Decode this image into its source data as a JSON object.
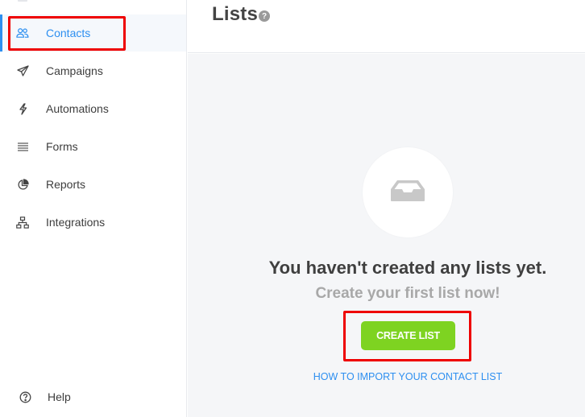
{
  "sidebar": {
    "items": [
      {
        "label": "Contacts",
        "icon": "users-icon",
        "active": true
      },
      {
        "label": "Campaigns",
        "icon": "paper-plane-icon"
      },
      {
        "label": "Automations",
        "icon": "lightning-icon"
      },
      {
        "label": "Forms",
        "icon": "lines-icon"
      },
      {
        "label": "Reports",
        "icon": "pie-chart-icon"
      },
      {
        "label": "Integrations",
        "icon": "sitemap-icon"
      }
    ],
    "help_label": "Help"
  },
  "header": {
    "title": "Lists",
    "help_glyph": "?"
  },
  "empty_state": {
    "icon": "inbox-icon",
    "title": "You haven't created any lists yet.",
    "subtitle": "Create your first list now!",
    "create_button_label": "CREATE LIST",
    "import_link_label": "HOW TO IMPORT YOUR CONTACT LIST"
  },
  "colors": {
    "accent": "#2d8ff0",
    "primary_button": "#7ed321",
    "highlight": "#ee0000"
  }
}
